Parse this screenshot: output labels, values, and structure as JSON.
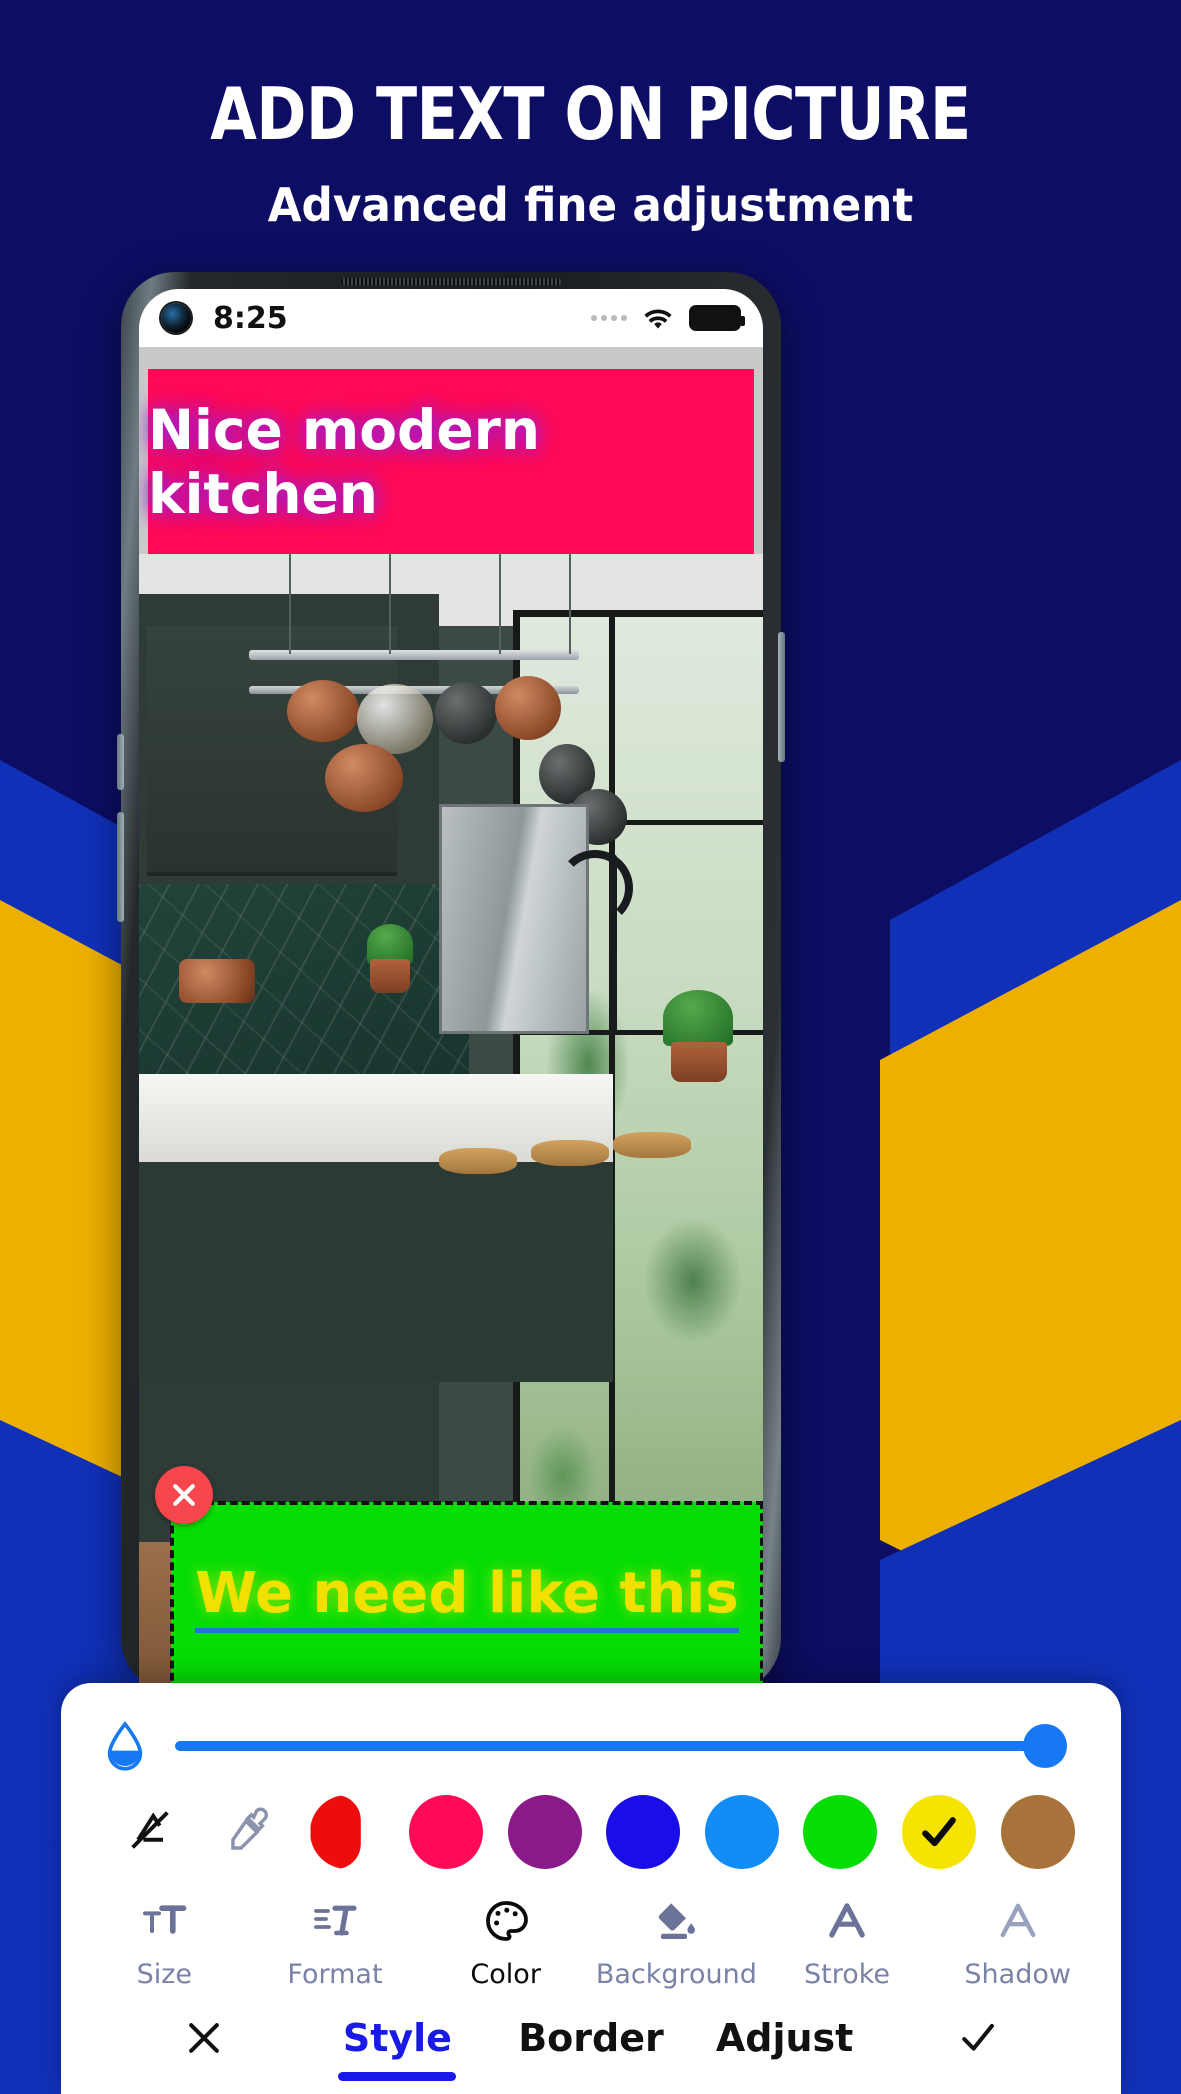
{
  "promo": {
    "title": "ADD TEXT ON PICTURE",
    "subtitle": "Advanced fine adjustment",
    "bg_color": "#0d0d63",
    "accent_blue": "#1030b8",
    "accent_yellow": "#edb000"
  },
  "status_bar": {
    "time": "8:25",
    "wifi_icon": "wifi-icon",
    "battery_icon": "battery-full-icon",
    "signal_icon": "signal-dots-icon",
    "camera_icon": "front-camera-punch-hole"
  },
  "canvas": {
    "top_text": {
      "content": "Nice modern kitchen",
      "text_color": "#ffffff",
      "background_color": "#ff0a56",
      "glow_color": "#b31bcd"
    },
    "bottom_text": {
      "content": "We need like this",
      "text_color": "#f2e000",
      "background_color": "#05dd05",
      "underline_color": "#2a6fd6",
      "selected": "true"
    },
    "delete_button_label": "close-icon"
  },
  "sheet": {
    "opacity_slider": {
      "icon": "opacity-droplet-icon",
      "value": 100,
      "track_color": "#1678f2"
    },
    "swatches": [
      {
        "name": "no-color",
        "type": "icon",
        "icon": "no-color-icon",
        "color": "#111111",
        "selected": false
      },
      {
        "name": "eyedropper",
        "type": "icon",
        "icon": "eyedropper-icon",
        "color": "#8c93ad",
        "selected": false
      },
      {
        "name": "red",
        "type": "color",
        "color": "#ee0d0d",
        "selected": false,
        "partial": true
      },
      {
        "name": "pink",
        "type": "color",
        "color": "#ff0a56",
        "selected": false
      },
      {
        "name": "purple",
        "type": "color",
        "color": "#8a1a8a",
        "selected": false
      },
      {
        "name": "blue",
        "type": "color",
        "color": "#1a0ee8",
        "selected": false
      },
      {
        "name": "light-blue",
        "type": "color",
        "color": "#128df5",
        "selected": false
      },
      {
        "name": "green",
        "type": "color",
        "color": "#05dd05",
        "selected": false
      },
      {
        "name": "yellow",
        "type": "color",
        "color": "#f5e400",
        "selected": true
      },
      {
        "name": "brown",
        "type": "color",
        "color": "#a8733a",
        "selected": false
      }
    ],
    "tools": [
      {
        "label": "Size",
        "icon": "text-size-icon",
        "active": false
      },
      {
        "label": "Format",
        "icon": "text-format-icon",
        "active": false
      },
      {
        "label": "Color",
        "icon": "palette-icon",
        "active": true
      },
      {
        "label": "Background",
        "icon": "fill-bucket-icon",
        "active": false
      },
      {
        "label": "Stroke",
        "icon": "letter-a-stroke-icon",
        "active": false
      },
      {
        "label": "Shadow",
        "icon": "letter-a-shadow-icon",
        "active": false
      }
    ],
    "tabs": [
      {
        "label": "",
        "icon": "close-icon",
        "active": false
      },
      {
        "label": "Style",
        "icon": "",
        "active": true
      },
      {
        "label": "Border",
        "icon": "",
        "active": false
      },
      {
        "label": "Adjust",
        "icon": "",
        "active": false
      },
      {
        "label": "",
        "icon": "check-icon",
        "active": false
      }
    ]
  }
}
